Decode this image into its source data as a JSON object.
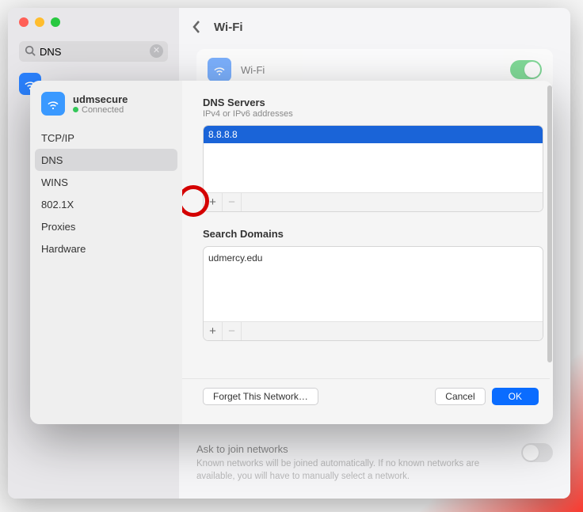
{
  "search": {
    "value": "DNS"
  },
  "header": {
    "back": "‹",
    "title": "Wi-Fi"
  },
  "wifi_row": {
    "label": "Wi-Fi",
    "toggle_on": true
  },
  "join": {
    "title": "Ask to join networks",
    "desc": "Known networks will be joined automatically. If no known networks are available, you will have to manually select a network."
  },
  "sheet": {
    "network": {
      "name": "udmsecure",
      "status": "Connected"
    },
    "tabs": [
      "TCP/IP",
      "DNS",
      "WINS",
      "802.1X",
      "Proxies",
      "Hardware"
    ],
    "active_tab": 1,
    "dns": {
      "title": "DNS Servers",
      "subtitle": "IPv4 or IPv6 addresses",
      "entry": "8.8.8.8"
    },
    "domains": {
      "title": "Search Domains",
      "entry": "udmercy.edu"
    },
    "footer": {
      "forget": "Forget This Network…",
      "cancel": "Cancel",
      "ok": "OK"
    }
  }
}
